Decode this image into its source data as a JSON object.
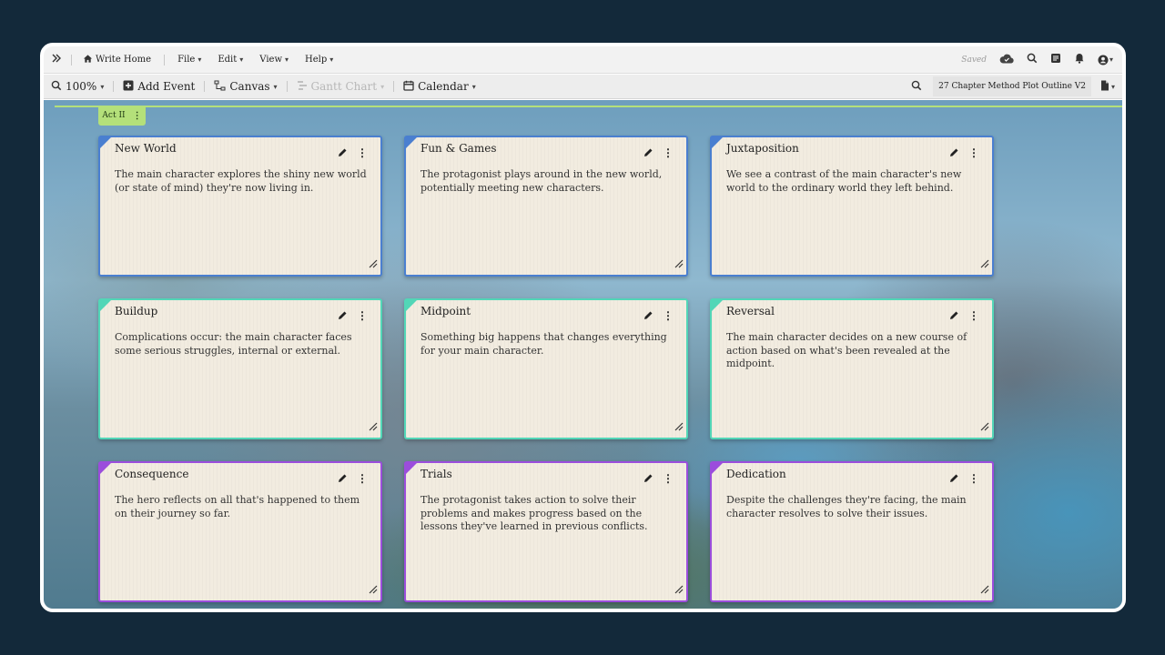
{
  "menubar": {
    "home_label": "Write Home",
    "menus": [
      "File",
      "Edit",
      "View",
      "Help"
    ],
    "saved_label": "Saved"
  },
  "toolbar": {
    "zoom": "100%",
    "add_event": "Add Event",
    "canvas": "Canvas",
    "gantt_chart": "Gantt Chart",
    "calendar": "Calendar",
    "document_name": "27 Chapter Method Plot Outline V2"
  },
  "act": {
    "label": "Act II"
  },
  "colors": {
    "blue": "#4a7fd0",
    "teal": "#52d6b7",
    "purple": "#9b4ddc",
    "act": "#b4e07a"
  },
  "cards": [
    {
      "title": "New World",
      "description": "The main character explores the shiny new world (or state of mind) they're now living in."
    },
    {
      "title": "Fun & Games",
      "description": "The protagonist plays around in the new world, potentially meeting new characters."
    },
    {
      "title": "Juxtaposition",
      "description": "We see a contrast of the main character's new world to the ordinary world they left behind."
    },
    {
      "title": "Buildup",
      "description": "Complications occur: the main character faces some serious struggles, internal or external."
    },
    {
      "title": "Midpoint",
      "description": "Something big happens that changes everything for your main character."
    },
    {
      "title": "Reversal",
      "description": "The main character decides on a new course of action based on what's been revealed at the midpoint."
    },
    {
      "title": "Consequence",
      "description": "The hero reflects on all that's happened to them on their journey so far."
    },
    {
      "title": "Trials",
      "description": "The protagonist takes action to solve their problems and makes progress based on the lessons they've learned in previous conflicts."
    },
    {
      "title": "Dedication",
      "description": "Despite the challenges they're facing, the main character resolves to solve their issues."
    }
  ]
}
